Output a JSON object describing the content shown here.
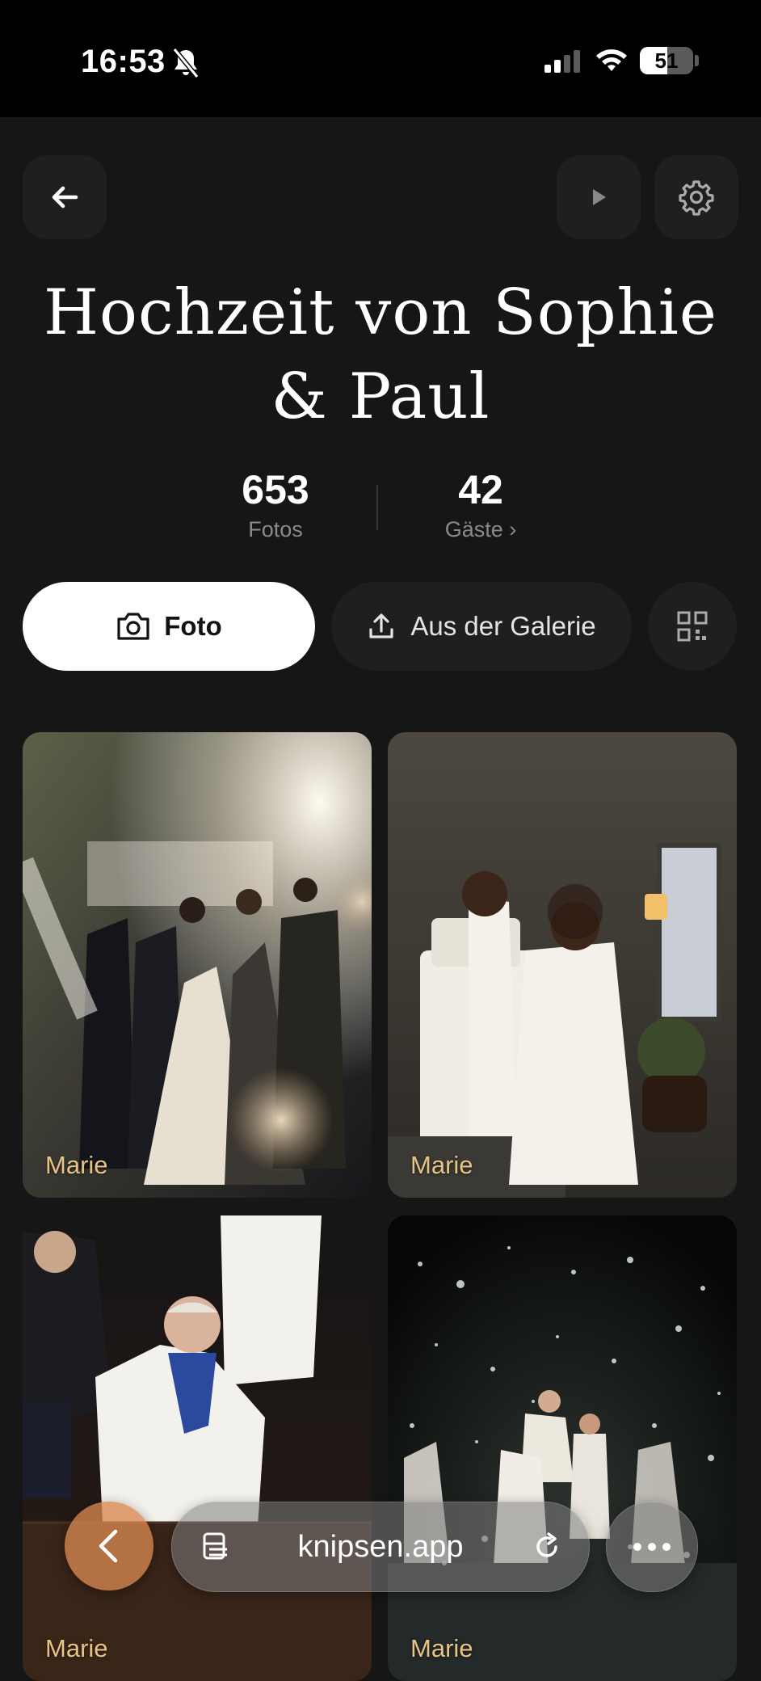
{
  "status_bar": {
    "time": "16:53",
    "battery_percent": 51,
    "battery_label": "51",
    "icons": [
      "bell-slash-icon",
      "cellular-signal-icon",
      "wifi-icon",
      "battery-icon"
    ]
  },
  "header": {
    "back_icon": "arrow-left-icon",
    "slideshow_icon": "play-icon",
    "settings_icon": "gear-icon"
  },
  "event": {
    "title": "Hochzeit von Sophie & Paul"
  },
  "stats": {
    "photos_count": "653",
    "photos_label": "Fotos",
    "guests_count": "42",
    "guests_label": "Gäste ›"
  },
  "actions": {
    "photo_button_label": "Foto",
    "gallery_button_label": "Aus der Galerie",
    "photo_button_icon": "camera-icon",
    "gallery_button_icon": "upload-icon",
    "qr_button_icon": "qr-code-icon"
  },
  "photos": [
    {
      "author": "Marie",
      "description": "wedding-party-champagne-spray"
    },
    {
      "author": "Marie",
      "description": "couple-cake-cutting"
    },
    {
      "author": "Marie",
      "description": "guests-dancing"
    },
    {
      "author": "Marie",
      "description": "confetti-night-dance"
    }
  ],
  "browser": {
    "url": "knipsen.app",
    "back_icon": "chevron-left-icon",
    "reader_icon": "reader-icon",
    "reload_icon": "reload-icon",
    "more_icon": "ellipsis-icon"
  },
  "colors": {
    "background": "#161616",
    "status_bar": "#000000",
    "author_label": "#e8c484",
    "browser_back_accent": "#d78750"
  }
}
